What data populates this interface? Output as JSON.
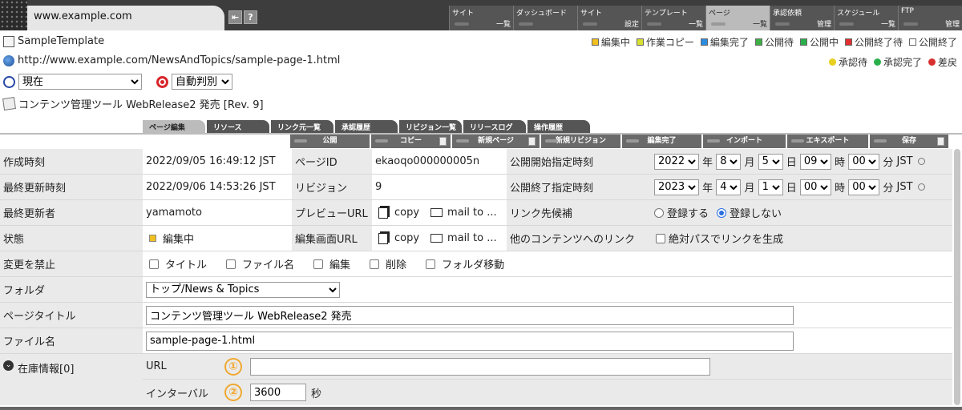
{
  "topbar": {
    "url": "www.example.com",
    "menu": [
      {
        "l1": "サイト",
        "l2": "一覧"
      },
      {
        "l1": "ダッシュボード",
        "l2": ""
      },
      {
        "l1": "サイト",
        "l2": "設定"
      },
      {
        "l1": "テンプレート",
        "l2": "一覧"
      },
      {
        "l1": "ページ",
        "l2": "一覧"
      },
      {
        "l1": "承認依頼",
        "l2": "管理"
      },
      {
        "l1": "スケジュール",
        "l2": "一覧"
      },
      {
        "l1": "FTP",
        "l2": "管理"
      }
    ]
  },
  "header": {
    "template": "SampleTemplate",
    "page_url": "http://www.example.com/NewsAndTopics/sample-page-1.html",
    "time_select": "現在",
    "auto_select": "自動判別",
    "title_line": "コンテンツ管理ツール WebRelease2 発売 [Rev. 9]"
  },
  "legend_top": [
    {
      "label": "編集中",
      "color": "#f0c020"
    },
    {
      "label": "作業コピー",
      "color": "#d8e030"
    },
    {
      "label": "編集完了",
      "color": "#2a8de0"
    },
    {
      "label": "公開待",
      "color": "#3cb043"
    },
    {
      "label": "公開中",
      "color": "#2ab04a"
    },
    {
      "label": "公開終了待",
      "color": "#e03030"
    },
    {
      "label": "公開終了",
      "color": "#ffffff"
    }
  ],
  "legend_bottom": [
    {
      "label": "承認待",
      "color": "#e8d020"
    },
    {
      "label": "承認完了",
      "color": "#2ab04a"
    },
    {
      "label": "差戻",
      "color": "#d83030"
    }
  ],
  "tabs": [
    "ページ編集",
    "リソース",
    "リンク元一覧",
    "承認履歴",
    "リビジョン一覧",
    "リリースログ",
    "操作履歴"
  ],
  "actions": [
    "公開",
    "コピー",
    "新規ページ",
    "新規リビジョン",
    "編集完了",
    "インポート",
    "エキスポート",
    "保存"
  ],
  "form": {
    "created_label": "作成時刻",
    "created": "2022/09/05 16:49:12 JST",
    "pageid_label": "ページID",
    "pageid": "ekaoqo000000005n",
    "pub_start_label": "公開開始指定時刻",
    "pub_start": {
      "year": "2022",
      "month": "8",
      "day": "5",
      "hour": "09",
      "min": "00"
    },
    "updated_label": "最終更新時刻",
    "updated": "2022/09/06 14:53:26 JST",
    "revision_label": "リビジョン",
    "revision": "9",
    "pub_end_label": "公開終了指定時刻",
    "pub_end": {
      "year": "2023",
      "month": "4",
      "day": "1",
      "hour": "00",
      "min": "00"
    },
    "u_year": "年",
    "u_month": "月",
    "u_day": "日",
    "u_hour": "時",
    "u_min": "分",
    "tz": "JST",
    "updater_label": "最終更新者",
    "updater": "yamamoto",
    "preview_label": "プレビューURL",
    "copy": "copy",
    "mailto": "mail to ...",
    "link_cand_label": "リンク先候補",
    "reg_yes": "登録する",
    "reg_no": "登録しない",
    "status_label": "状態",
    "status": "編集中",
    "editurl_label": "編集画面URL",
    "otherlink_label": "他のコンテンツへのリンク",
    "abs_path": "絶対パスでリンクを生成",
    "lock_label": "変更を禁止",
    "lock_items": [
      "タイトル",
      "ファイル名",
      "編集",
      "削除",
      "フォルダ移動"
    ],
    "folder_label": "フォルダ",
    "folder": "トップ/News & Topics",
    "title_label": "ページタイトル",
    "title": "コンテンツ管理ツール WebRelease2 発売",
    "file_label": "ファイル名",
    "file": "sample-page-1.html",
    "stock_label": "在庫情報[0]",
    "url_label": "URL",
    "url_num": "①",
    "url_value": "",
    "interval_label": "インターバル",
    "interval_num": "②",
    "interval": "3600",
    "interval_unit": "秒"
  }
}
